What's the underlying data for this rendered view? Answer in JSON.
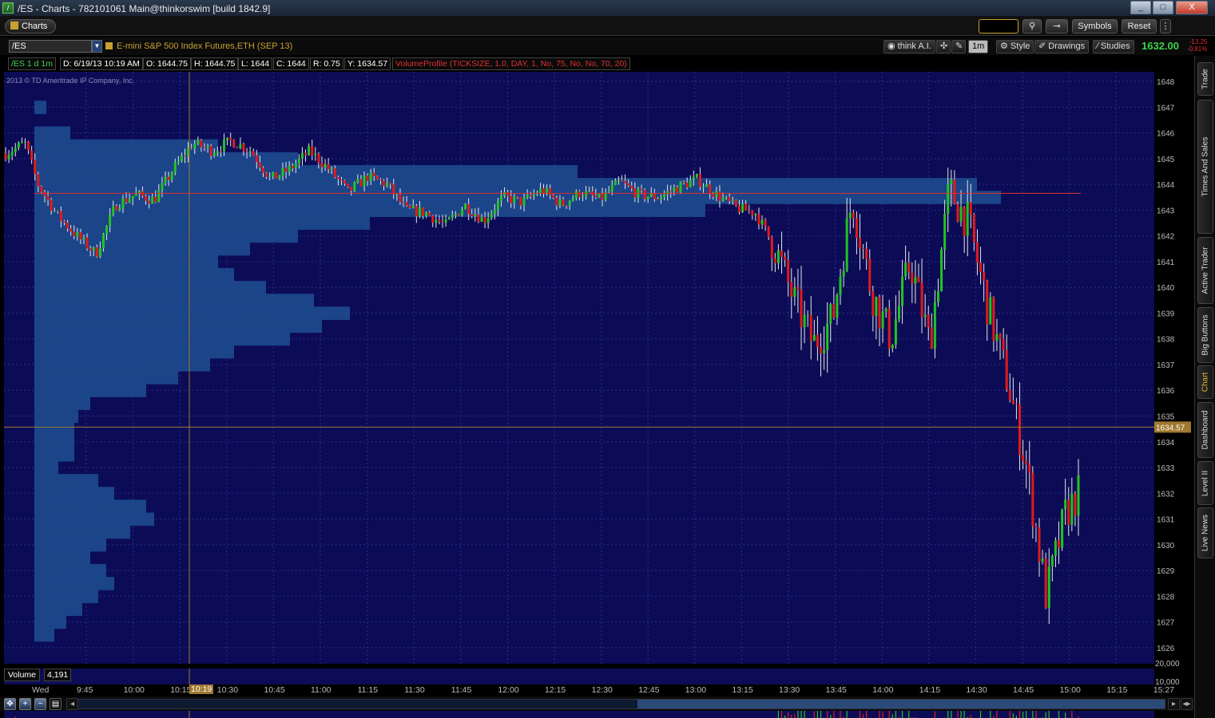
{
  "window": {
    "title": "/ES - Charts - 782101061 Main@thinkorswim [build 1842.9]",
    "buttons": {
      "minimize": "_",
      "maximize": "□",
      "close": "X"
    }
  },
  "toolbar": {
    "charts_tab": "Charts",
    "symbols": "Symbols",
    "reset": "Reset"
  },
  "header": {
    "symbol": "/ES",
    "description": "E-mini S&P 500 Index Futures,ETH (SEP 13)",
    "think_ai": "think A.I.",
    "timeframe": "1m",
    "style": "Style",
    "drawings": "Drawings",
    "studies": "Studies",
    "last_price": "1632.00",
    "net_change": "-13.25",
    "net_change_pct": "-0.81%"
  },
  "info_bar": {
    "symbol_tf": "/ES 1 d 1m",
    "date": "D: 6/19/13 10:19 AM",
    "open": "O: 1644.75",
    "high": "H: 1644.75",
    "low": "L: 1644",
    "close": "C: 1644",
    "range": "R: 0.75",
    "y": "Y: 1634.57",
    "study": "VolumeProfile (TICKSIZE, 1.0, DAY, 1, No, 75, No, No, 70, 20)"
  },
  "copyright": "2013 © TD Ameritrade IP Company, Inc.",
  "volume_pane": {
    "label": "Volume",
    "value": "4,191"
  },
  "crosshair_price_label": "1634.57",
  "crosshair_time_label": "10:19",
  "colors": {
    "background": "#0c0c56",
    "up_candle": "#22c322",
    "down_candle": "#e01b1b",
    "profile": "#1e4f92",
    "poc_line": "#e0302e",
    "crosshair": "#a07830",
    "accent": "#c8a030"
  },
  "side_tabs": [
    "Trade",
    "Times And Sales",
    "Active Trader",
    "Big Buttons",
    "Chart",
    "Dashboard",
    "Level II",
    "Live News"
  ],
  "chart_data": {
    "type": "candlestick",
    "y_axis_ticks": [
      "1648",
      "1647",
      "1646",
      "1645",
      "1644",
      "1643",
      "1642",
      "1641",
      "1640",
      "1639",
      "1638",
      "1637",
      "1636",
      "1635",
      "1634",
      "1633",
      "1632",
      "1631",
      "1630",
      "1629",
      "1628",
      "1627",
      "1626"
    ],
    "ylim": [
      1625.5,
      1648.25
    ],
    "x_axis_ticks": [
      "Wed",
      "9:45",
      "10:00",
      "10:15",
      "10:30",
      "10:45",
      "11:00",
      "11:15",
      "11:30",
      "11:45",
      "12:00",
      "12:15",
      "12:30",
      "12:45",
      "13:00",
      "13:15",
      "13:30",
      "13:45",
      "14:00",
      "14:15",
      "14:30",
      "14:45",
      "15:00",
      "15:15",
      "15:27"
    ],
    "volume_ticks": [
      "20,000",
      "10,000"
    ],
    "poc_price": 1643.65,
    "close_path": [
      [
        0,
        1645.2
      ],
      [
        15,
        1645.6
      ],
      [
        25,
        1644.0
      ],
      [
        40,
        1642.8
      ],
      [
        55,
        1642.0
      ],
      [
        70,
        1641.3
      ],
      [
        85,
        1643.2
      ],
      [
        100,
        1643.6
      ],
      [
        115,
        1643.4
      ],
      [
        130,
        1644.6
      ],
      [
        145,
        1645.6
      ],
      [
        160,
        1645.3
      ],
      [
        175,
        1645.7
      ],
      [
        190,
        1645.3
      ],
      [
        205,
        1644.2
      ],
      [
        220,
        1644.6
      ],
      [
        235,
        1645.3
      ],
      [
        250,
        1644.6
      ],
      [
        265,
        1643.7
      ],
      [
        280,
        1644.3
      ],
      [
        295,
        1644.0
      ],
      [
        310,
        1643.0
      ],
      [
        325,
        1642.9
      ],
      [
        340,
        1642.4
      ],
      [
        355,
        1643.2
      ],
      [
        370,
        1642.6
      ],
      [
        385,
        1643.5
      ],
      [
        400,
        1643.3
      ],
      [
        415,
        1643.8
      ],
      [
        430,
        1643.2
      ],
      [
        445,
        1643.7
      ],
      [
        460,
        1643.4
      ],
      [
        475,
        1644.1
      ],
      [
        490,
        1643.6
      ],
      [
        505,
        1643.5
      ],
      [
        520,
        1643.9
      ],
      [
        535,
        1644.2
      ],
      [
        550,
        1643.6
      ],
      [
        565,
        1643.1
      ],
      [
        580,
        1642.9
      ],
      [
        595,
        1641.6
      ],
      [
        610,
        1639.5
      ],
      [
        625,
        1637.8
      ],
      [
        640,
        1638.8
      ],
      [
        655,
        1643.5
      ],
      [
        670,
        1639.8
      ],
      [
        685,
        1638.0
      ],
      [
        700,
        1641.0
      ],
      [
        715,
        1637.8
      ],
      [
        730,
        1643.8
      ],
      [
        745,
        1642.5
      ],
      [
        760,
        1639.2
      ],
      [
        775,
        1636.4
      ],
      [
        790,
        1633.0
      ],
      [
        805,
        1628.0
      ],
      [
        820,
        1631.2
      ],
      [
        830,
        1632.0
      ]
    ]
  }
}
